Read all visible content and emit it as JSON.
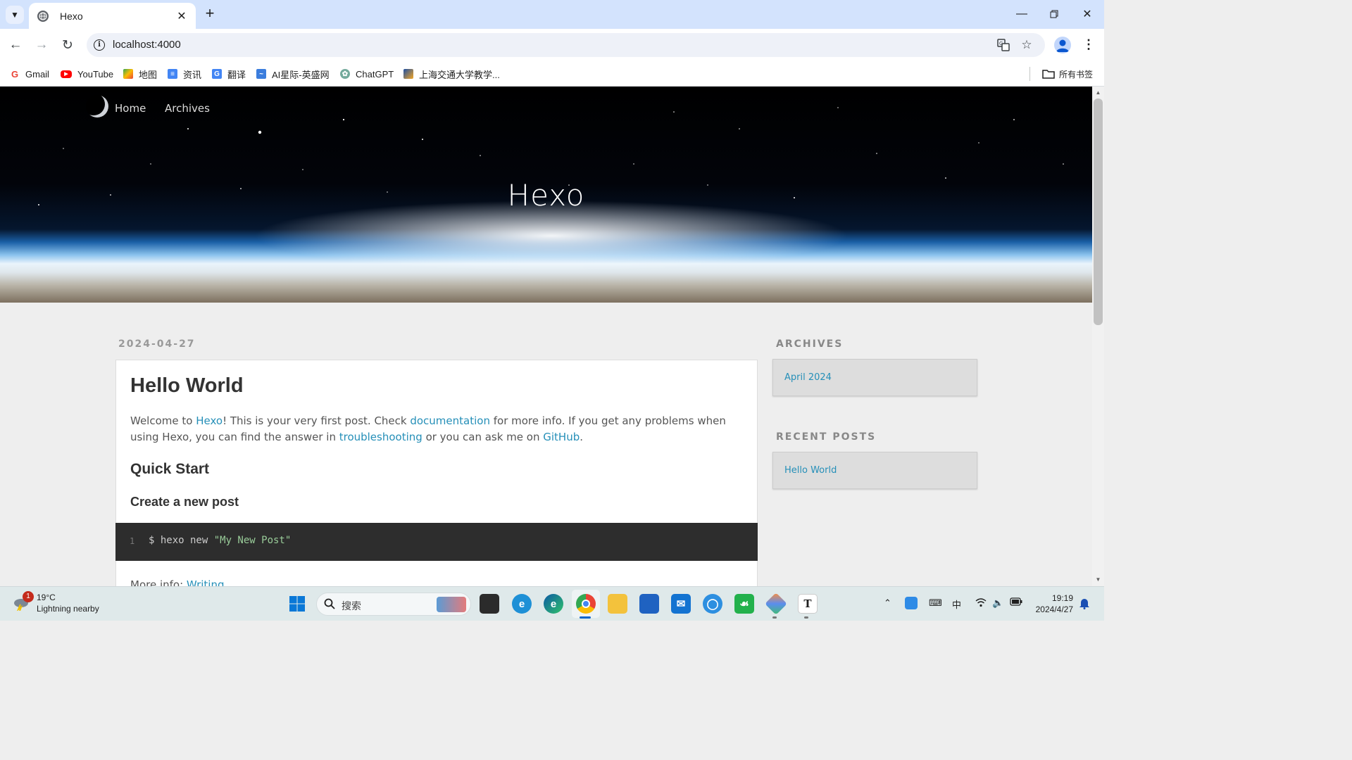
{
  "browser": {
    "tab_title": "Hexo",
    "url": "localhost:4000",
    "bookmarks": [
      {
        "label": "Gmail",
        "icon": "gmail-icon",
        "color": "#ea4335"
      },
      {
        "label": "YouTube",
        "icon": "youtube-icon",
        "color": "#ff0000"
      },
      {
        "label": "地图",
        "icon": "maps-icon",
        "color": "#34a853"
      },
      {
        "label": "资讯",
        "icon": "news-icon",
        "color": "#4285f4"
      },
      {
        "label": "翻译",
        "icon": "translate-icon",
        "color": "#4285f4"
      },
      {
        "label": "AI星际-英盛网",
        "icon": "ai-site-icon",
        "color": "#3b7ddd"
      },
      {
        "label": "ChatGPT",
        "icon": "chatgpt-icon",
        "color": "#74aa9c"
      },
      {
        "label": "上海交通大学教学...",
        "icon": "sjtu-icon",
        "color": "#1d4fa3"
      }
    ],
    "all_bookmarks_label": "所有书签"
  },
  "site": {
    "nav": {
      "home": "Home",
      "archives": "Archives"
    },
    "title": "Hexo"
  },
  "post": {
    "date": "2024-04-27",
    "title": "Hello World",
    "intro": {
      "t1": "Welcome to ",
      "link_hexo": "Hexo",
      "t2": "! This is your very first post. Check ",
      "link_docs": "documentation",
      "t3": " for more info. If you get any problems when using Hexo, you can find the answer in ",
      "link_trouble": "troubleshooting",
      "t4": " or you can ask me on ",
      "link_github": "GitHub",
      "t5": "."
    },
    "h2": "Quick Start",
    "h3": "Create a new post",
    "code": {
      "line_no": "1",
      "cmd": "$ hexo new ",
      "arg": "\"My New Post\""
    },
    "more_info": {
      "label": "More info: ",
      "link": "Writing"
    }
  },
  "sidebar": {
    "archives_title": "ARCHIVES",
    "archives_items": [
      "April 2024"
    ],
    "recent_title": "RECENT POSTS",
    "recent_items": [
      "Hello World"
    ]
  },
  "taskbar": {
    "weather": {
      "badge": "1",
      "temp": "19°C",
      "desc": "Lightning nearby"
    },
    "search_placeholder": "搜索",
    "ime": "中",
    "time": "19:19",
    "date": "2024/4/27"
  },
  "colors": {
    "link": "#258fb8",
    "accent": "#1a73e8"
  }
}
